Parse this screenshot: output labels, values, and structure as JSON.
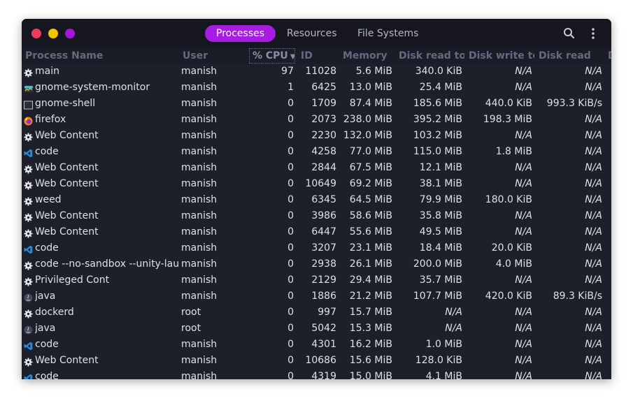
{
  "tabs": [
    {
      "label": "Processes",
      "active": true
    },
    {
      "label": "Resources",
      "active": false
    },
    {
      "label": "File Systems",
      "active": false
    }
  ],
  "header_icons": [
    "search-icon",
    "menu-icon"
  ],
  "columns": {
    "name": "Process Name",
    "user": "User",
    "cpu": "% CPU",
    "id": "ID",
    "memory": "Memory",
    "disk_read_total": "Disk read tota",
    "disk_write_total": "Disk write tot",
    "disk_read": "Disk read",
    "extra": "D"
  },
  "sort": {
    "column": "cpu",
    "direction": "descending"
  },
  "colors": {
    "accent": "#a71be3",
    "window_bg": "#1d1f2a",
    "text": "#dfe0e8"
  },
  "rows": [
    {
      "icon": "gear-icon",
      "name": "main",
      "user": "manish",
      "cpu": "97",
      "id": "11028",
      "memory": "5.6 MiB",
      "disk_read_total": "340.0 KiB",
      "disk_write_total": "N/A",
      "disk_read": "N/A"
    },
    {
      "icon": "system-monitor-icon",
      "name": "gnome-system-monitor",
      "user": "manish",
      "cpu": "1",
      "id": "6425",
      "memory": "13.0 MiB",
      "disk_read_total": "25.4 MiB",
      "disk_write_total": "N/A",
      "disk_read": "N/A"
    },
    {
      "icon": "window-icon",
      "name": "gnome-shell",
      "user": "manish",
      "cpu": "0",
      "id": "1709",
      "memory": "87.4 MiB",
      "disk_read_total": "185.6 MiB",
      "disk_write_total": "440.0 KiB",
      "disk_read": "993.3 KiB/s"
    },
    {
      "icon": "firefox-icon",
      "name": "firefox",
      "user": "manish",
      "cpu": "0",
      "id": "2073",
      "memory": "238.0 MiB",
      "disk_read_total": "395.2 MiB",
      "disk_write_total": "198.3 MiB",
      "disk_read": "N/A"
    },
    {
      "icon": "gear-icon",
      "name": "Web Content",
      "user": "manish",
      "cpu": "0",
      "id": "2230",
      "memory": "132.0 MiB",
      "disk_read_total": "103.2 MiB",
      "disk_write_total": "N/A",
      "disk_read": "N/A"
    },
    {
      "icon": "vscode-icon",
      "name": "code",
      "user": "manish",
      "cpu": "0",
      "id": "4258",
      "memory": "77.0 MiB",
      "disk_read_total": "115.0 MiB",
      "disk_write_total": "1.8 MiB",
      "disk_read": "N/A"
    },
    {
      "icon": "gear-icon",
      "name": "Web Content",
      "user": "manish",
      "cpu": "0",
      "id": "2844",
      "memory": "67.5 MiB",
      "disk_read_total": "12.1 MiB",
      "disk_write_total": "N/A",
      "disk_read": "N/A"
    },
    {
      "icon": "gear-icon",
      "name": "Web Content",
      "user": "manish",
      "cpu": "0",
      "id": "10649",
      "memory": "69.2 MiB",
      "disk_read_total": "38.1 MiB",
      "disk_write_total": "N/A",
      "disk_read": "N/A"
    },
    {
      "icon": "gear-icon",
      "name": "weed",
      "user": "manish",
      "cpu": "0",
      "id": "6345",
      "memory": "64.5 MiB",
      "disk_read_total": "79.9 MiB",
      "disk_write_total": "180.0 KiB",
      "disk_read": "N/A"
    },
    {
      "icon": "gear-icon",
      "name": "Web Content",
      "user": "manish",
      "cpu": "0",
      "id": "3986",
      "memory": "58.6 MiB",
      "disk_read_total": "35.8 MiB",
      "disk_write_total": "N/A",
      "disk_read": "N/A"
    },
    {
      "icon": "gear-icon",
      "name": "Web Content",
      "user": "manish",
      "cpu": "0",
      "id": "6447",
      "memory": "55.6 MiB",
      "disk_read_total": "49.5 MiB",
      "disk_write_total": "N/A",
      "disk_read": "N/A"
    },
    {
      "icon": "vscode-icon",
      "name": "code",
      "user": "manish",
      "cpu": "0",
      "id": "3207",
      "memory": "23.1 MiB",
      "disk_read_total": "18.4 MiB",
      "disk_write_total": "20.0 KiB",
      "disk_read": "N/A"
    },
    {
      "icon": "gear-icon",
      "name": "code --no-sandbox --unity-launc",
      "user": "manish",
      "cpu": "0",
      "id": "2938",
      "memory": "26.1 MiB",
      "disk_read_total": "200.0 MiB",
      "disk_write_total": "4.0 MiB",
      "disk_read": "N/A"
    },
    {
      "icon": "gear-icon",
      "name": "Privileged Cont",
      "user": "manish",
      "cpu": "0",
      "id": "2129",
      "memory": "29.4 MiB",
      "disk_read_total": "35.7 MiB",
      "disk_write_total": "N/A",
      "disk_read": "N/A"
    },
    {
      "icon": "java-icon",
      "name": "java",
      "user": "manish",
      "cpu": "0",
      "id": "1886",
      "memory": "21.2 MiB",
      "disk_read_total": "107.7 MiB",
      "disk_write_total": "420.0 KiB",
      "disk_read": "89.3 KiB/s"
    },
    {
      "icon": "gear-icon",
      "name": "dockerd",
      "user": "root",
      "cpu": "0",
      "id": "997",
      "memory": "15.7 MiB",
      "disk_read_total": "N/A",
      "disk_write_total": "N/A",
      "disk_read": "N/A"
    },
    {
      "icon": "java-icon",
      "name": "java",
      "user": "root",
      "cpu": "0",
      "id": "5042",
      "memory": "15.3 MiB",
      "disk_read_total": "N/A",
      "disk_write_total": "N/A",
      "disk_read": "N/A"
    },
    {
      "icon": "vscode-icon",
      "name": "code",
      "user": "manish",
      "cpu": "0",
      "id": "4301",
      "memory": "16.2 MiB",
      "disk_read_total": "1.0 MiB",
      "disk_write_total": "N/A",
      "disk_read": "N/A"
    },
    {
      "icon": "gear-icon",
      "name": "Web Content",
      "user": "manish",
      "cpu": "0",
      "id": "10686",
      "memory": "15.6 MiB",
      "disk_read_total": "128.0 KiB",
      "disk_write_total": "N/A",
      "disk_read": "N/A"
    },
    {
      "icon": "vscode-icon",
      "name": "code",
      "user": "manish",
      "cpu": "0",
      "id": "4319",
      "memory": "15.0 MiB",
      "disk_read_total": "4.1 MiB",
      "disk_write_total": "N/A",
      "disk_read": "N/A"
    }
  ]
}
